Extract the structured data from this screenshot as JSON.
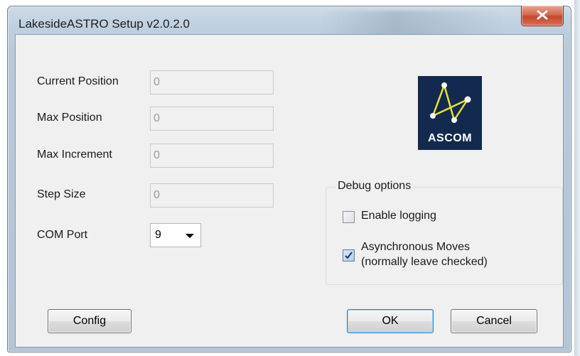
{
  "window": {
    "title": "LakesideASTRO Setup v2.0.2.0"
  },
  "fields": {
    "current_position": {
      "label": "Current Position",
      "value": "0"
    },
    "max_position": {
      "label": "Max Position",
      "value": "0"
    },
    "max_increment": {
      "label": "Max Increment",
      "value": "0"
    },
    "step_size": {
      "label": "Step Size",
      "value": "0"
    }
  },
  "com_port": {
    "label": "COM Port",
    "selected": "9"
  },
  "logo": {
    "text": "ASCOM",
    "icon": "ascom-logo"
  },
  "debug": {
    "title": "Debug options",
    "enable_logging": {
      "label": "Enable logging",
      "checked": false
    },
    "async_moves": {
      "label_line1": "Asynchronous Moves",
      "label_line2": "(normally leave checked)",
      "checked": true
    }
  },
  "buttons": {
    "config": "Config",
    "ok": "OK",
    "cancel": "Cancel"
  },
  "colors": {
    "logo_background": "#13294d",
    "logo_lines": "#e6e23a",
    "close_button": "#c4472b",
    "default_button_border": "#3c7fb1"
  }
}
